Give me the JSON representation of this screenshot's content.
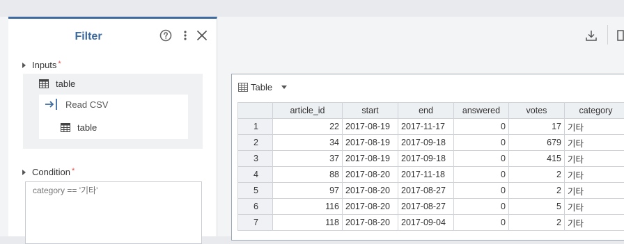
{
  "filter_panel": {
    "title": "Filter",
    "inputs_label": "Inputs",
    "required_mark": "*",
    "inputs": {
      "table_label": "table",
      "source_label": "Read CSV",
      "source_output_label": "table"
    },
    "condition_label": "Condition",
    "condition_placeholder": "category == '기타'"
  },
  "toolbar": {
    "table_selector_label": "Table"
  },
  "table": {
    "columns": [
      "",
      "article_id",
      "start",
      "end",
      "answered",
      "votes",
      "category"
    ],
    "rows": [
      [
        "1",
        "22",
        "2017-08-19",
        "2017-11-17",
        "0",
        "17",
        "기타"
      ],
      [
        "2",
        "34",
        "2017-08-19",
        "2017-09-18",
        "0",
        "679",
        "기타"
      ],
      [
        "3",
        "37",
        "2017-08-19",
        "2017-09-18",
        "0",
        "415",
        "기타"
      ],
      [
        "4",
        "88",
        "2017-08-20",
        "2017-11-18",
        "0",
        "2",
        "기타"
      ],
      [
        "5",
        "97",
        "2017-08-20",
        "2017-08-27",
        "0",
        "2",
        "기타"
      ],
      [
        "6",
        "116",
        "2017-08-20",
        "2017-08-27",
        "0",
        "5",
        "기타"
      ],
      [
        "7",
        "118",
        "2017-08-20",
        "2017-09-04",
        "0",
        "2",
        "기타"
      ]
    ]
  },
  "colors": {
    "accent": "#3d6aa0",
    "required": "#e34b4b",
    "table_border": "#9aa5b8"
  },
  "icons": [
    "help-icon",
    "more-icon",
    "close-icon",
    "download-icon",
    "table-icon",
    "import-icon",
    "caret-right-icon",
    "caret-down-icon"
  ]
}
